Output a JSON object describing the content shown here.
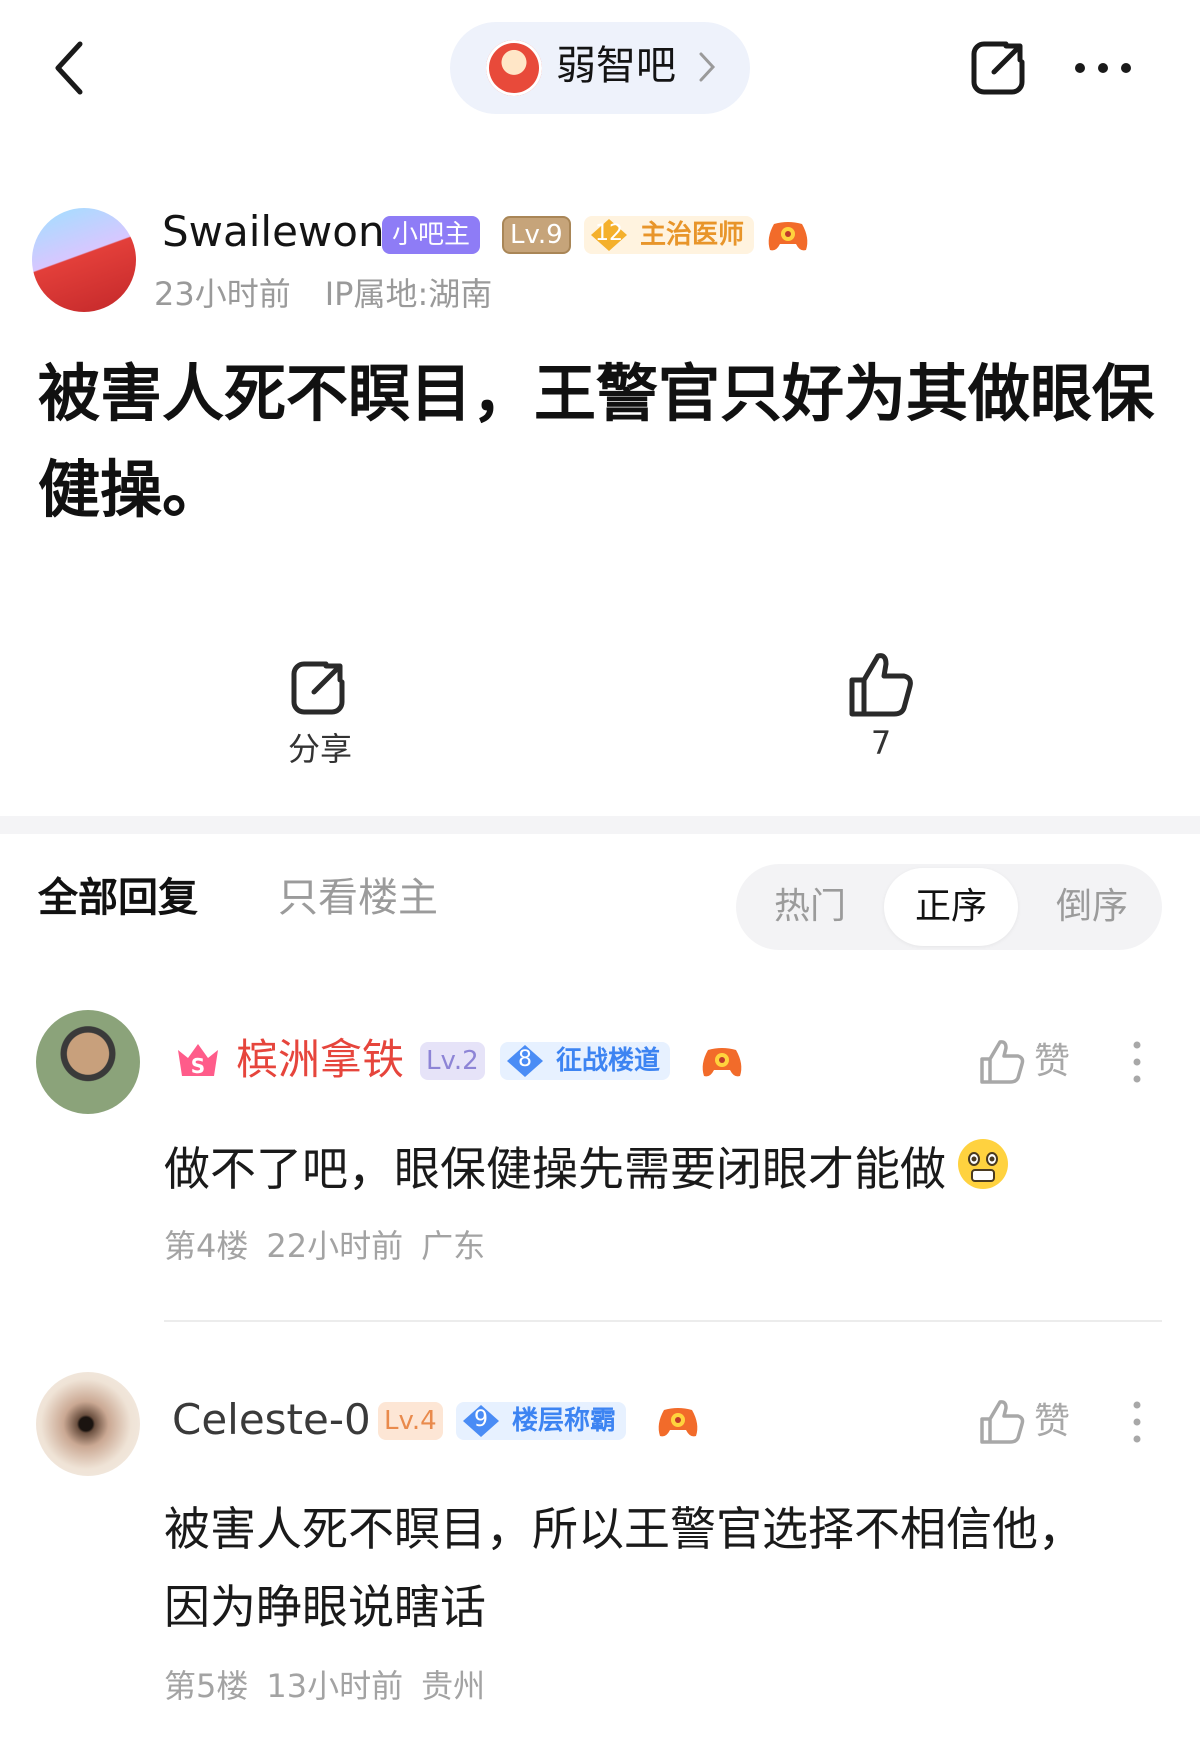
{
  "header": {
    "forum_name": "弱智吧",
    "forum_icon": "teletubby-po-icon",
    "back_icon": "back-chevron-icon",
    "share_icon": "share-icon",
    "more_icon": "more-dots-icon"
  },
  "post": {
    "author": {
      "name": "Swailewon",
      "role_badge": "小吧主",
      "level": "Lv.9",
      "title_level": "12",
      "title": "主治医师",
      "time": "23小时前",
      "ip": "IP属地:湖南"
    },
    "title": "被害人死不瞑目，王警官只好为其做眼保健操。",
    "actions": {
      "share_label": "分享",
      "like_count": "7"
    }
  },
  "replies_header": {
    "tab_all": "全部回复",
    "tab_op_only": "只看楼主",
    "sort_hot": "热门",
    "sort_asc": "正序",
    "sort_desc": "倒序",
    "active_sort": "正序"
  },
  "replies": [
    {
      "name": "槟洲拿铁",
      "name_color": "#e6453c",
      "level": "Lv.2",
      "title_level": "8",
      "title": "征战楼道",
      "like_label": "赞",
      "text": "做不了吧，眼保健操先需要闭眼才能做",
      "emoji": "shocked-face-emoji",
      "floor": "第4楼",
      "time": "22小时前",
      "location": "广东"
    },
    {
      "name": "Celeste-0",
      "level": "Lv.4",
      "title_level": "9",
      "title": "楼层称霸",
      "like_label": "赞",
      "text_line1": "被害人死不瞑目，所以王警官选择不相信他，",
      "text_line2": "因为睁眼说瞎话",
      "floor": "第5楼",
      "time": "13小时前",
      "location": "贵州"
    }
  ],
  "colors": {
    "accent_blue": "#3d84f2",
    "owner_badge": "#8e7cf6",
    "gold_title": "#e8952a"
  }
}
